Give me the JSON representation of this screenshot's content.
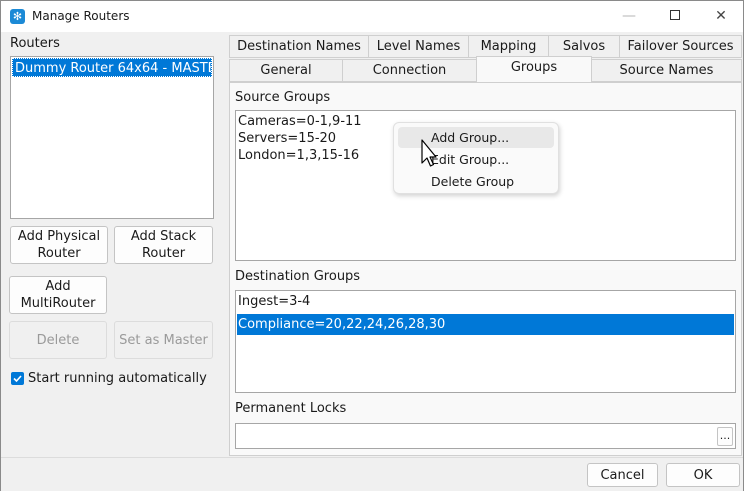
{
  "window": {
    "title": "Manage Routers",
    "app_icon": "gear-flower-icon",
    "controls": {
      "minimize": "—",
      "close": "✕"
    }
  },
  "left": {
    "routers_label": "Routers",
    "routers": [
      "Dummy Router 64x64 - MASTER"
    ],
    "buttons": {
      "add_physical": "Add Physical Router",
      "add_stack": "Add Stack Router",
      "add_multi": "Add MultiRouter",
      "delete": "Delete",
      "set_master": "Set as Master"
    },
    "start_auto": {
      "label": "Start running automatically",
      "checked": true
    }
  },
  "tabs": {
    "row_top": [
      "Destination Names",
      "Level Names",
      "Mapping",
      "Salvos",
      "Failover Sources"
    ],
    "row_bottom": [
      "General",
      "Connection",
      "Groups",
      "Source Names"
    ],
    "active": "Groups"
  },
  "groups": {
    "source_label": "Source Groups",
    "source_items": [
      "Cameras=0-1,9-11",
      "Servers=15-20",
      "London=1,3,15-16"
    ],
    "destination_label": "Destination Groups",
    "destination_items": [
      "Ingest=3-4",
      "Compliance=20,22,24,26,28,30"
    ],
    "destination_selected": "Compliance=20,22,24,26,28,30",
    "locks_label": "Permanent Locks",
    "locks_value": "",
    "ellipsis": "..."
  },
  "context_menu": {
    "items": [
      "Add Group...",
      "Edit Group...",
      "Delete Group"
    ],
    "hovered": "Add Group..."
  },
  "footer": {
    "cancel": "Cancel",
    "ok": "OK"
  },
  "colors": {
    "accent": "#0078d7",
    "app_icon": "#1c8ad6"
  }
}
